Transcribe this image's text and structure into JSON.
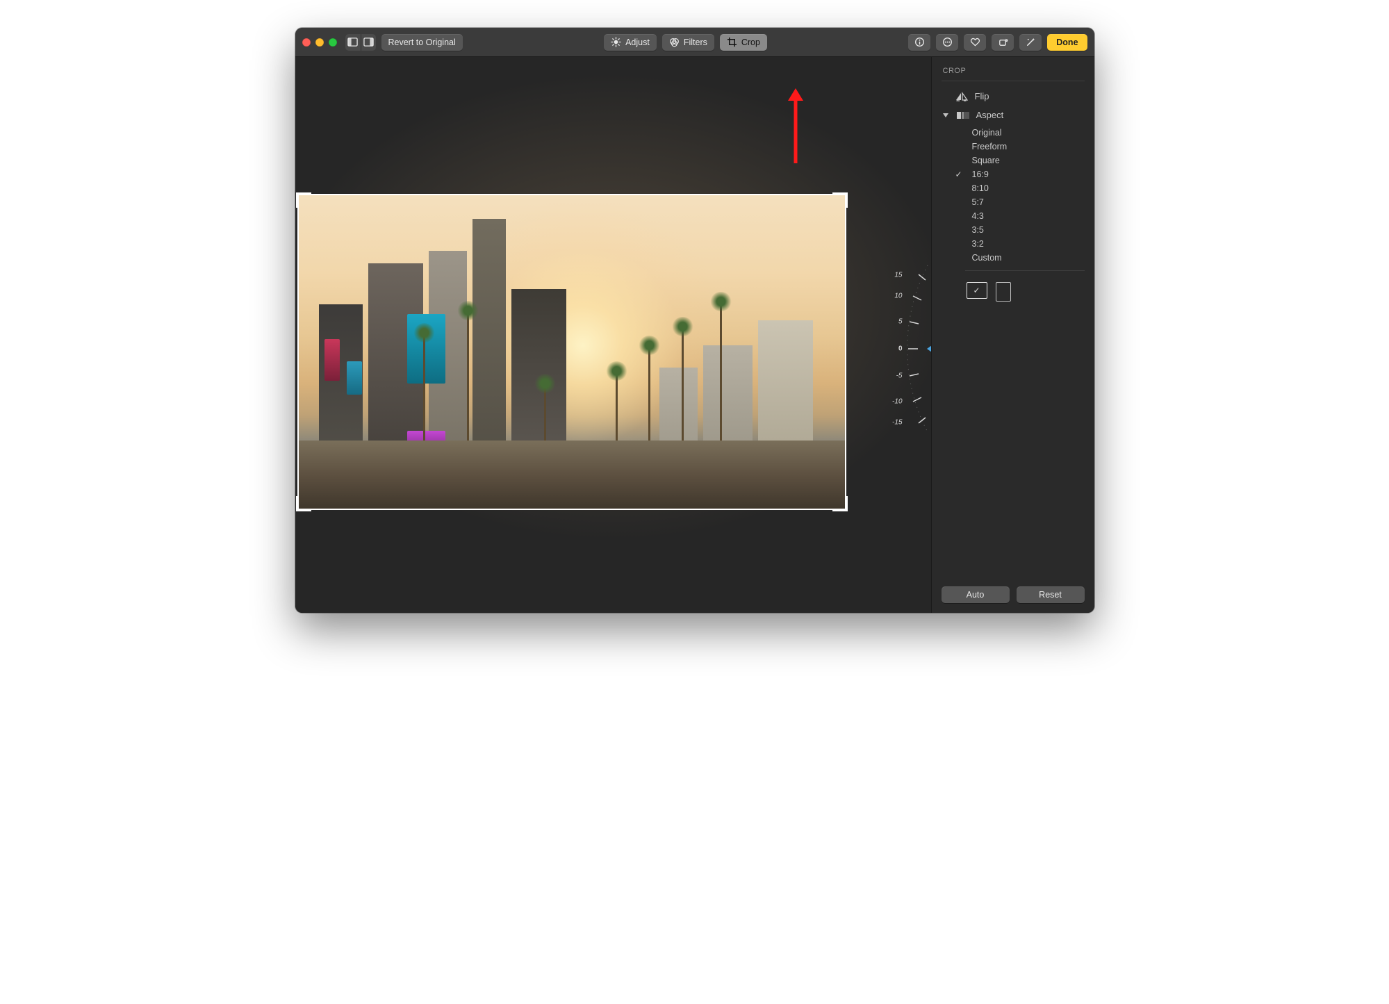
{
  "toolbar": {
    "revert_label": "Revert to Original",
    "adjust_label": "Adjust",
    "filters_label": "Filters",
    "crop_label": "Crop",
    "done_label": "Done"
  },
  "dial": {
    "ticks": [
      "15",
      "10",
      "5",
      "0",
      "-5",
      "-10",
      "-15"
    ],
    "value": "0"
  },
  "sidebar": {
    "title": "CROP",
    "flip_label": "Flip",
    "aspect_label": "Aspect",
    "aspect_options": [
      {
        "label": "Original",
        "selected": false
      },
      {
        "label": "Freeform",
        "selected": false
      },
      {
        "label": "Square",
        "selected": false
      },
      {
        "label": "16:9",
        "selected": true
      },
      {
        "label": "8:10",
        "selected": false
      },
      {
        "label": "5:7",
        "selected": false
      },
      {
        "label": "4:3",
        "selected": false
      },
      {
        "label": "3:5",
        "selected": false
      },
      {
        "label": "3:2",
        "selected": false
      },
      {
        "label": "Custom",
        "selected": false
      }
    ],
    "auto_label": "Auto",
    "reset_label": "Reset"
  }
}
